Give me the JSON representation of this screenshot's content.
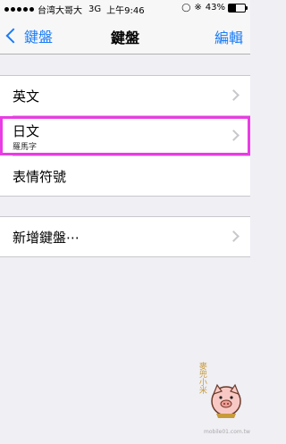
{
  "status_bar": {
    "carrier": "台湾大哥大",
    "network": "3G",
    "time": "上午9:46",
    "battery": "43%",
    "battery_level": 0.43,
    "icons": [
      "signal-dots-icon",
      "rotation-lock-icon",
      "bluetooth-icon",
      "battery-icon"
    ]
  },
  "nav": {
    "back_label": "鍵盤",
    "title": "鍵盤",
    "edit_label": "編輯"
  },
  "group1": [
    {
      "label": "英文",
      "sublabel": "",
      "has_chevron": true
    },
    {
      "label": "日文",
      "sublabel": "羅馬字",
      "has_chevron": true,
      "highlighted": true
    },
    {
      "label": "表情符號",
      "sublabel": "",
      "has_chevron": false
    }
  ],
  "group2": [
    {
      "label": "新增鍵盤⋯",
      "has_chevron": true
    }
  ],
  "watermark": {
    "text": "麥兜小米",
    "caption": "mobile01.com.tw"
  },
  "colors": {
    "tint": "#1a7cf5",
    "highlight_border": "#e93ce4",
    "background": "#efeff4"
  }
}
